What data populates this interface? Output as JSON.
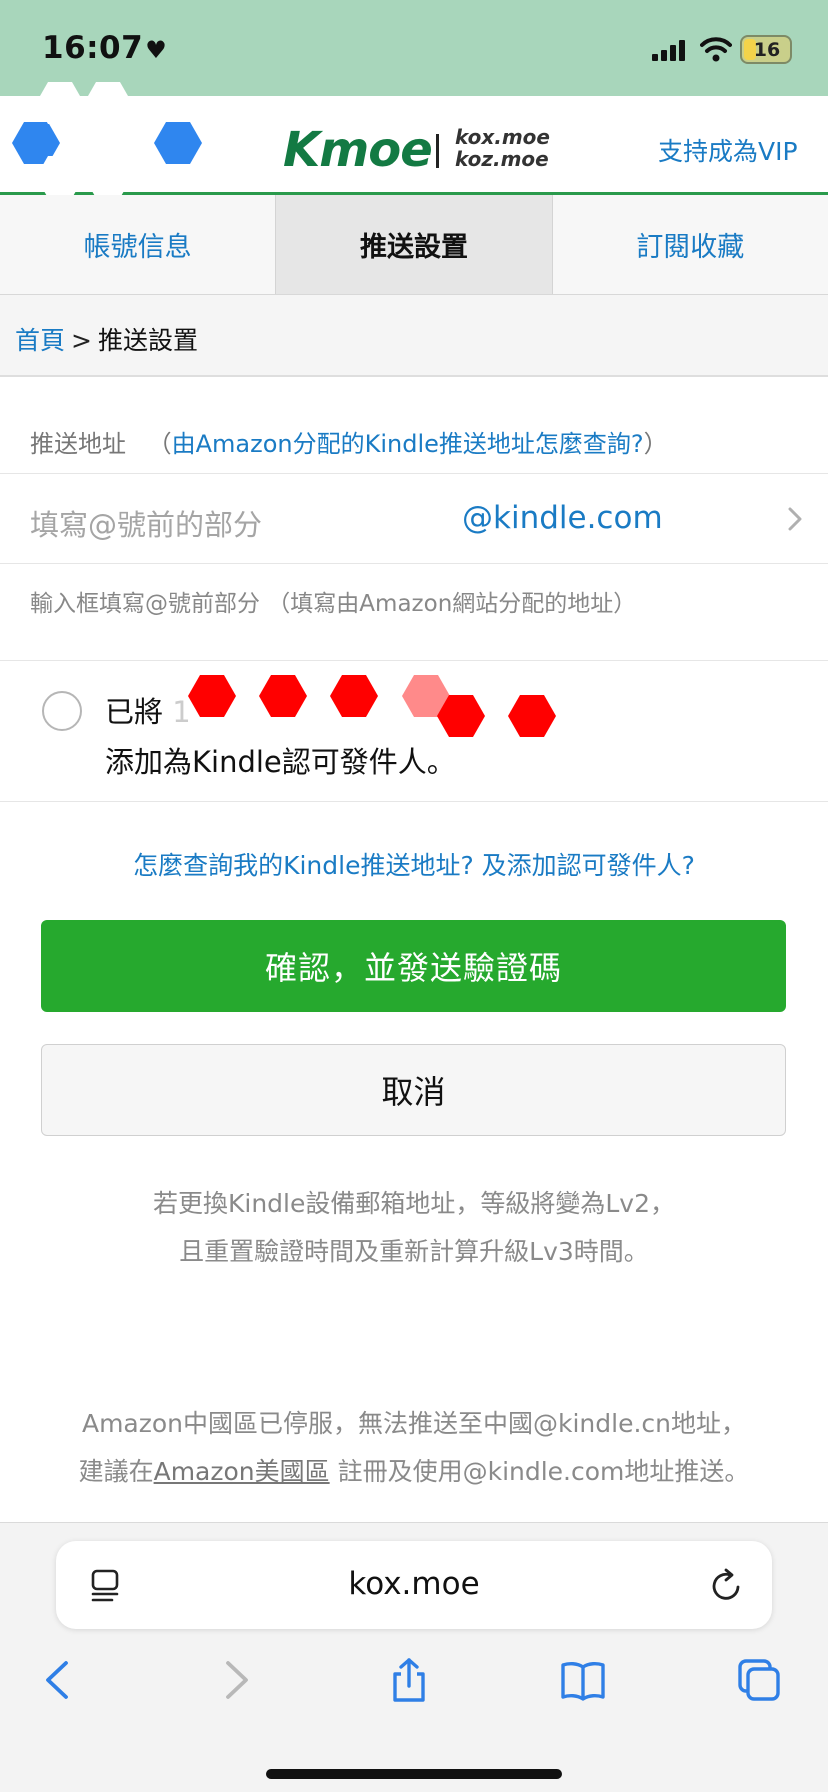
{
  "status": {
    "time": "16:07",
    "heart": "♥",
    "battery": "16"
  },
  "header": {
    "logo": "Kmoe",
    "domains": [
      "kox.moe",
      "koz.moe"
    ],
    "vip_link": "支持成為VIP"
  },
  "tabs": [
    {
      "label": "帳號信息",
      "active": false
    },
    {
      "label": "推送設置",
      "active": true
    },
    {
      "label": "訂閱收藏",
      "active": false
    }
  ],
  "breadcrumb": {
    "home": "首頁",
    "separator": ">",
    "current": "推送設置"
  },
  "form": {
    "address_label": "推送地址",
    "address_help_open": "（",
    "address_help_link": "由Amazon分配的Kindle推送地址怎麼查詢?",
    "address_help_close": "）",
    "input_placeholder": "填寫@號前的部分",
    "input_suffix": "@kindle.com",
    "input_hint": "輸入框填寫@號前部分 （填寫由Amazon網站分配的地址）",
    "approve_prefix": "已將",
    "approve_partial": "1",
    "approve_line2": "添加為Kindle認可發件人。"
  },
  "help_link": "怎麼查詢我的Kindle推送地址? 及添加認可發件人?",
  "buttons": {
    "confirm": "確認，並發送驗證碼",
    "cancel": "取消"
  },
  "note": {
    "line1": "若更換Kindle設備郵箱地址，等級將變為Lv2，",
    "line2": "且重置驗證時間及重新計算升級Lv3時間。"
  },
  "footer": {
    "line1": "Amazon中國區已停服，無法推送至中國@kindle.cn地址，",
    "line2_pre": "建議在",
    "line2_link": "Amazon美國區",
    "line2_post": " 註冊及使用@kindle.com地址推送。"
  },
  "browser": {
    "url": "kox.moe"
  },
  "colors": {
    "accent_blue": "#1a7bc4",
    "confirm_green": "#26a92e",
    "status_bg": "#a8d6bb",
    "brand_green": "#137a43"
  }
}
